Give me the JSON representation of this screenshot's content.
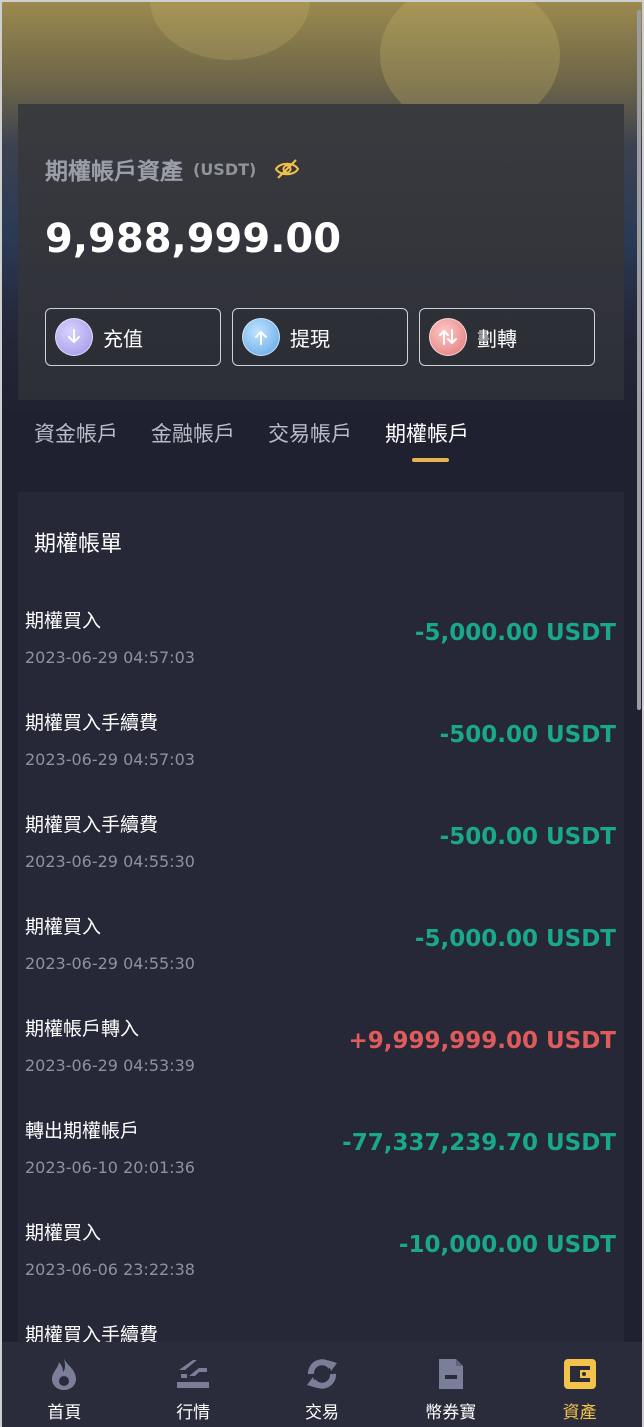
{
  "account": {
    "title": "期權帳戶資產",
    "unit": "(USDT)",
    "balance": "9,988,999.00"
  },
  "actions": [
    {
      "label": "充值",
      "icon": "deposit-icon"
    },
    {
      "label": "提現",
      "icon": "withdraw-icon"
    },
    {
      "label": "劃轉",
      "icon": "transfer-icon"
    }
  ],
  "tabs": [
    {
      "label": "資金帳戶",
      "active": false
    },
    {
      "label": "金融帳戶",
      "active": false
    },
    {
      "label": "交易帳戶",
      "active": false
    },
    {
      "label": "期權帳戶",
      "active": true
    }
  ],
  "ledger": {
    "title": "期權帳單",
    "records": [
      {
        "name": "期權買入",
        "time": "2023-06-29 04:57:03",
        "amount": "-5,000.00 USDT",
        "positive": false
      },
      {
        "name": "期權買入手續費",
        "time": "2023-06-29 04:57:03",
        "amount": "-500.00 USDT",
        "positive": false
      },
      {
        "name": "期權買入手續費",
        "time": "2023-06-29 04:55:30",
        "amount": "-500.00 USDT",
        "positive": false
      },
      {
        "name": "期權買入",
        "time": "2023-06-29 04:55:30",
        "amount": "-5,000.00 USDT",
        "positive": false
      },
      {
        "name": "期權帳戶轉入",
        "time": "2023-06-29 04:53:39",
        "amount": "+9,999,999.00 USDT",
        "positive": true
      },
      {
        "name": "轉出期權帳戶",
        "time": "2023-06-10 20:01:36",
        "amount": "-77,337,239.70 USDT",
        "positive": false
      },
      {
        "name": "期權買入",
        "time": "2023-06-06 23:22:38",
        "amount": "-10,000.00 USDT",
        "positive": false
      },
      {
        "name": "期權買入手續費",
        "time": "",
        "amount": "",
        "positive": false
      }
    ]
  },
  "nav": [
    {
      "label": "首頁",
      "icon": "home-flame-icon",
      "active": false
    },
    {
      "label": "行情",
      "icon": "market-icon",
      "active": false
    },
    {
      "label": "交易",
      "icon": "trade-refresh-icon",
      "active": false
    },
    {
      "label": "幣券寶",
      "icon": "document-icon",
      "active": false
    },
    {
      "label": "資產",
      "icon": "wallet-icon",
      "active": true
    }
  ],
  "colors": {
    "accent": "#f2c24a",
    "negative_amount": "#19a98a",
    "positive_amount": "#e05b5b"
  }
}
